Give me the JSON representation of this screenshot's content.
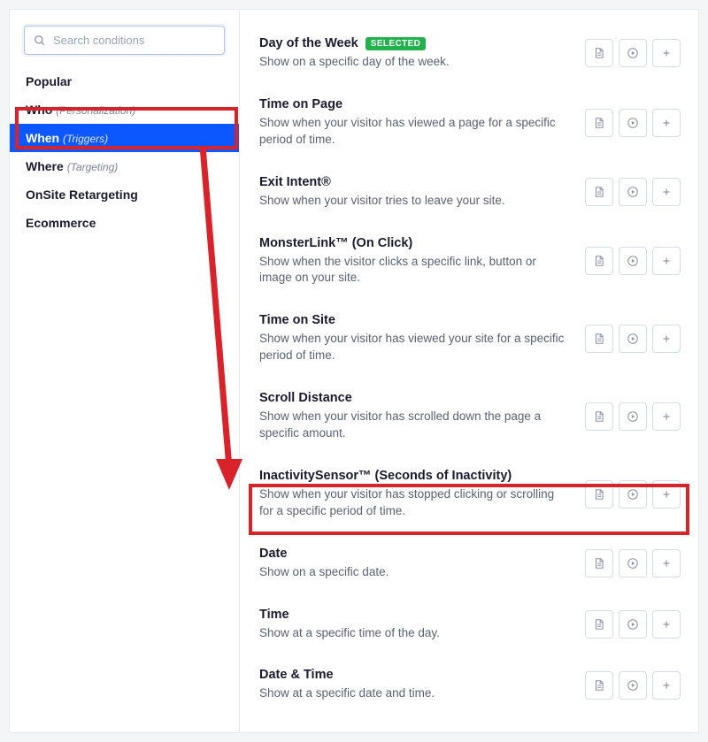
{
  "search": {
    "placeholder": "Search conditions"
  },
  "sidebar": {
    "items": [
      {
        "label": "Popular",
        "sub": ""
      },
      {
        "label": "Who",
        "sub": "(Personalization)"
      },
      {
        "label": "When",
        "sub": "(Triggers)"
      },
      {
        "label": "Where",
        "sub": "(Targeting)"
      },
      {
        "label": "OnSite Retargeting",
        "sub": ""
      },
      {
        "label": "Ecommerce",
        "sub": ""
      }
    ]
  },
  "badge_selected": "SELECTED",
  "conditions": [
    {
      "title": "Day of the Week",
      "desc": "Show on a specific day of the week.",
      "selected": true
    },
    {
      "title": "Time on Page",
      "desc": "Show when your visitor has viewed a page for a specific period of time."
    },
    {
      "title": "Exit Intent®",
      "desc": "Show when your visitor tries to leave your site."
    },
    {
      "title": "MonsterLink™ (On Click)",
      "desc": "Show when the visitor clicks a specific link, button or image on your site."
    },
    {
      "title": "Time on Site",
      "desc": "Show when your visitor has viewed your site for a specific period of time."
    },
    {
      "title": "Scroll Distance",
      "desc": "Show when your visitor has scrolled down the page a specific amount."
    },
    {
      "title": "InactivitySensor™ (Seconds of Inactivity)",
      "desc": "Show when your visitor has stopped clicking or scrolling for a specific period of time."
    },
    {
      "title": "Date",
      "desc": "Show on a specific date."
    },
    {
      "title": "Time",
      "desc": "Show at a specific time of the day."
    },
    {
      "title": "Date & Time",
      "desc": "Show at a specific date and time."
    }
  ]
}
